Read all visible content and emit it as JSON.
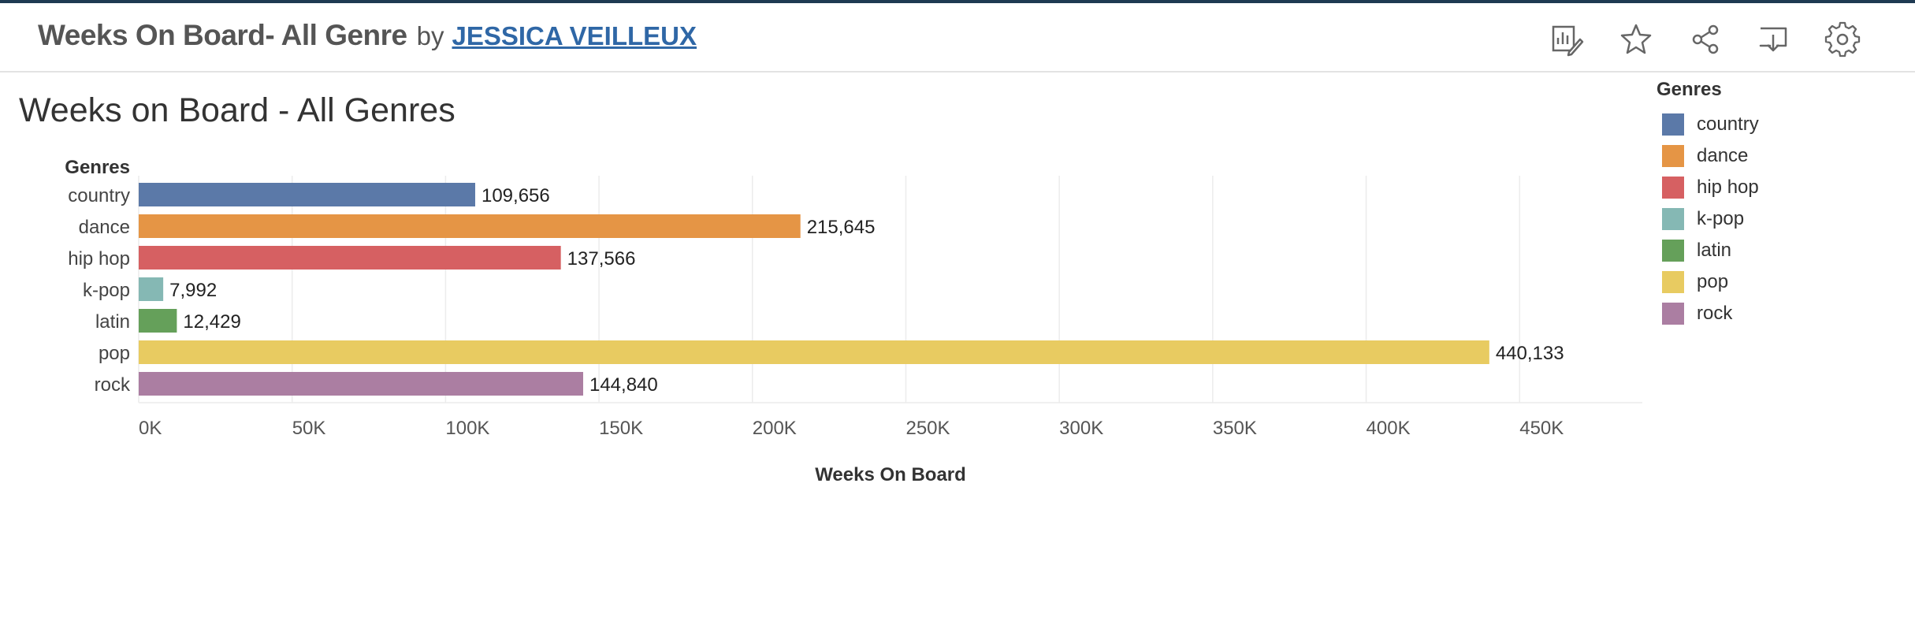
{
  "header": {
    "title": "Weeks On Board- All Genre",
    "by": "by",
    "author": "JESSICA VEILLEUX"
  },
  "toolbar": {
    "icons": [
      "edit-chart-icon",
      "star-icon",
      "share-icon",
      "download-icon",
      "settings-icon"
    ]
  },
  "sheet": {
    "title": "Weeks on Board - All Genres"
  },
  "legend": {
    "title": "Genres",
    "items": [
      {
        "label": "country",
        "color": "#5b79a8"
      },
      {
        "label": "dance",
        "color": "#e59545"
      },
      {
        "label": "hip hop",
        "color": "#d66062"
      },
      {
        "label": "k-pop",
        "color": "#85b8b4"
      },
      {
        "label": "latin",
        "color": "#65a05a"
      },
      {
        "label": "pop",
        "color": "#e8cb61"
      },
      {
        "label": "rock",
        "color": "#ab7ea2"
      }
    ]
  },
  "chart_data": {
    "type": "bar",
    "orientation": "horizontal",
    "title": "Weeks on Board - All Genres",
    "ylabel": "Genres",
    "xlabel": "Weeks On Board",
    "categories": [
      "country",
      "dance",
      "hip hop",
      "k-pop",
      "latin",
      "pop",
      "rock"
    ],
    "values": [
      109656,
      215645,
      137566,
      7992,
      12429,
      440133,
      144840
    ],
    "value_labels": [
      "109,656",
      "215,645",
      "137,566",
      "7,992",
      "12,429",
      "440,133",
      "144,840"
    ],
    "colors": [
      "#5b79a8",
      "#e59545",
      "#d66062",
      "#85b8b4",
      "#65a05a",
      "#e8cb61",
      "#ab7ea2"
    ],
    "xlim": [
      0,
      490000
    ],
    "xticks": [
      0,
      50000,
      100000,
      150000,
      200000,
      250000,
      300000,
      350000,
      400000,
      450000
    ],
    "xtick_labels": [
      "0K",
      "50K",
      "100K",
      "150K",
      "200K",
      "250K",
      "300K",
      "350K",
      "400K",
      "450K"
    ],
    "grid": true,
    "legend_position": "right"
  }
}
